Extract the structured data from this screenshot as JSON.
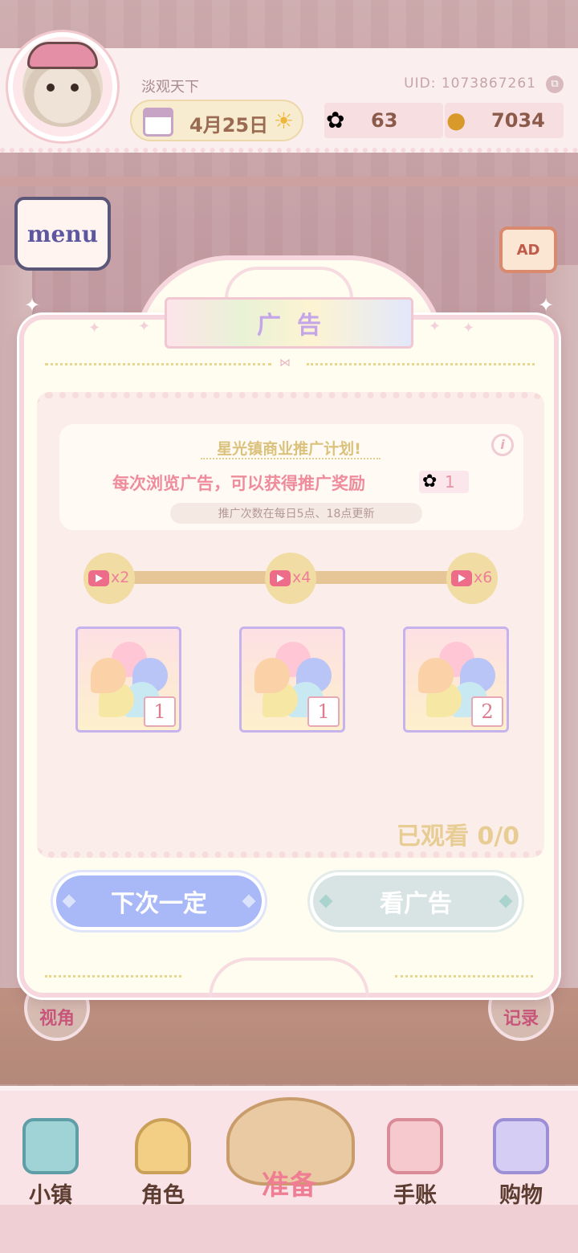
{
  "hud": {
    "username": "淡观天下",
    "uid": "UID: 1073867261",
    "date": "4月25日",
    "flower_count": "63",
    "coin_count": "7034"
  },
  "menu_label": "menu",
  "ad_label": "AD",
  "dialog": {
    "title": "广告",
    "info_title": "星光镇商业推广计划!",
    "info_main": "每次浏览广告，可以获得推广奖励",
    "info_reward": "1",
    "info_note": "推广次数在每日5点、18点更新",
    "milestones": [
      {
        "label": "x2"
      },
      {
        "label": "x4"
      },
      {
        "label": "x6"
      }
    ],
    "rewards": [
      {
        "count": "1"
      },
      {
        "count": "1"
      },
      {
        "count": "2"
      }
    ],
    "watched": "已观看 0/0",
    "btn_next": "下次一定",
    "btn_watch": "看广告"
  },
  "side": {
    "left_label": "视角",
    "right_label": "记录"
  },
  "nav": {
    "town": "小镇",
    "role": "角色",
    "prepare": "准备",
    "journal": "手账",
    "shop": "购物"
  },
  "colors": {
    "accent_pink": "#ef8c9c",
    "title_purple": "#c4a6e8",
    "button_blue": "#a9b8f7",
    "gold": "#dbc27c"
  }
}
